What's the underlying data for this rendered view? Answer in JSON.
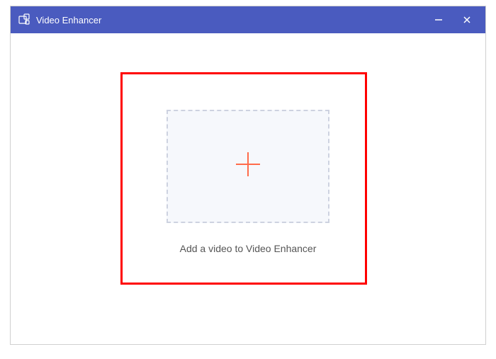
{
  "titlebar": {
    "app_title": "Video Enhancer"
  },
  "content": {
    "dropzone_label": "Add a video to Video Enhancer"
  }
}
